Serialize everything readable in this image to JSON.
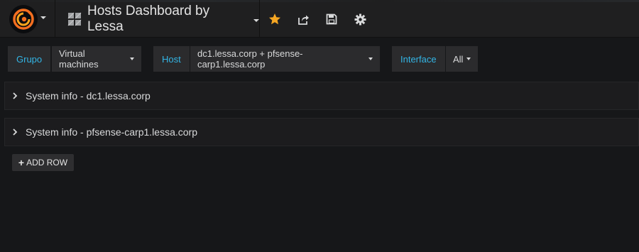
{
  "navbar": {
    "title": "Hosts Dashboard by Lessa",
    "icons": {
      "logo": "grafana-logo-icon",
      "dashboard": "dashboard-grid-icon",
      "star": "star-icon",
      "share": "share-icon",
      "save": "save-icon",
      "settings": "gear-icon"
    },
    "colors": {
      "star": "#f5a623",
      "logo": "#f46f20"
    }
  },
  "variables": [
    {
      "label": "Grupo",
      "value": "Virtual machines"
    },
    {
      "label": "Host",
      "value": "dc1.lessa.corp + pfsense-carp1.lessa.corp"
    },
    {
      "label": "Interface",
      "value": "All"
    }
  ],
  "rows": [
    {
      "title": "System info - dc1.lessa.corp"
    },
    {
      "title": "System info - pfsense-carp1.lessa.corp"
    }
  ],
  "add_row": {
    "label": "ADD ROW"
  },
  "accent_color": "#33b5e5"
}
